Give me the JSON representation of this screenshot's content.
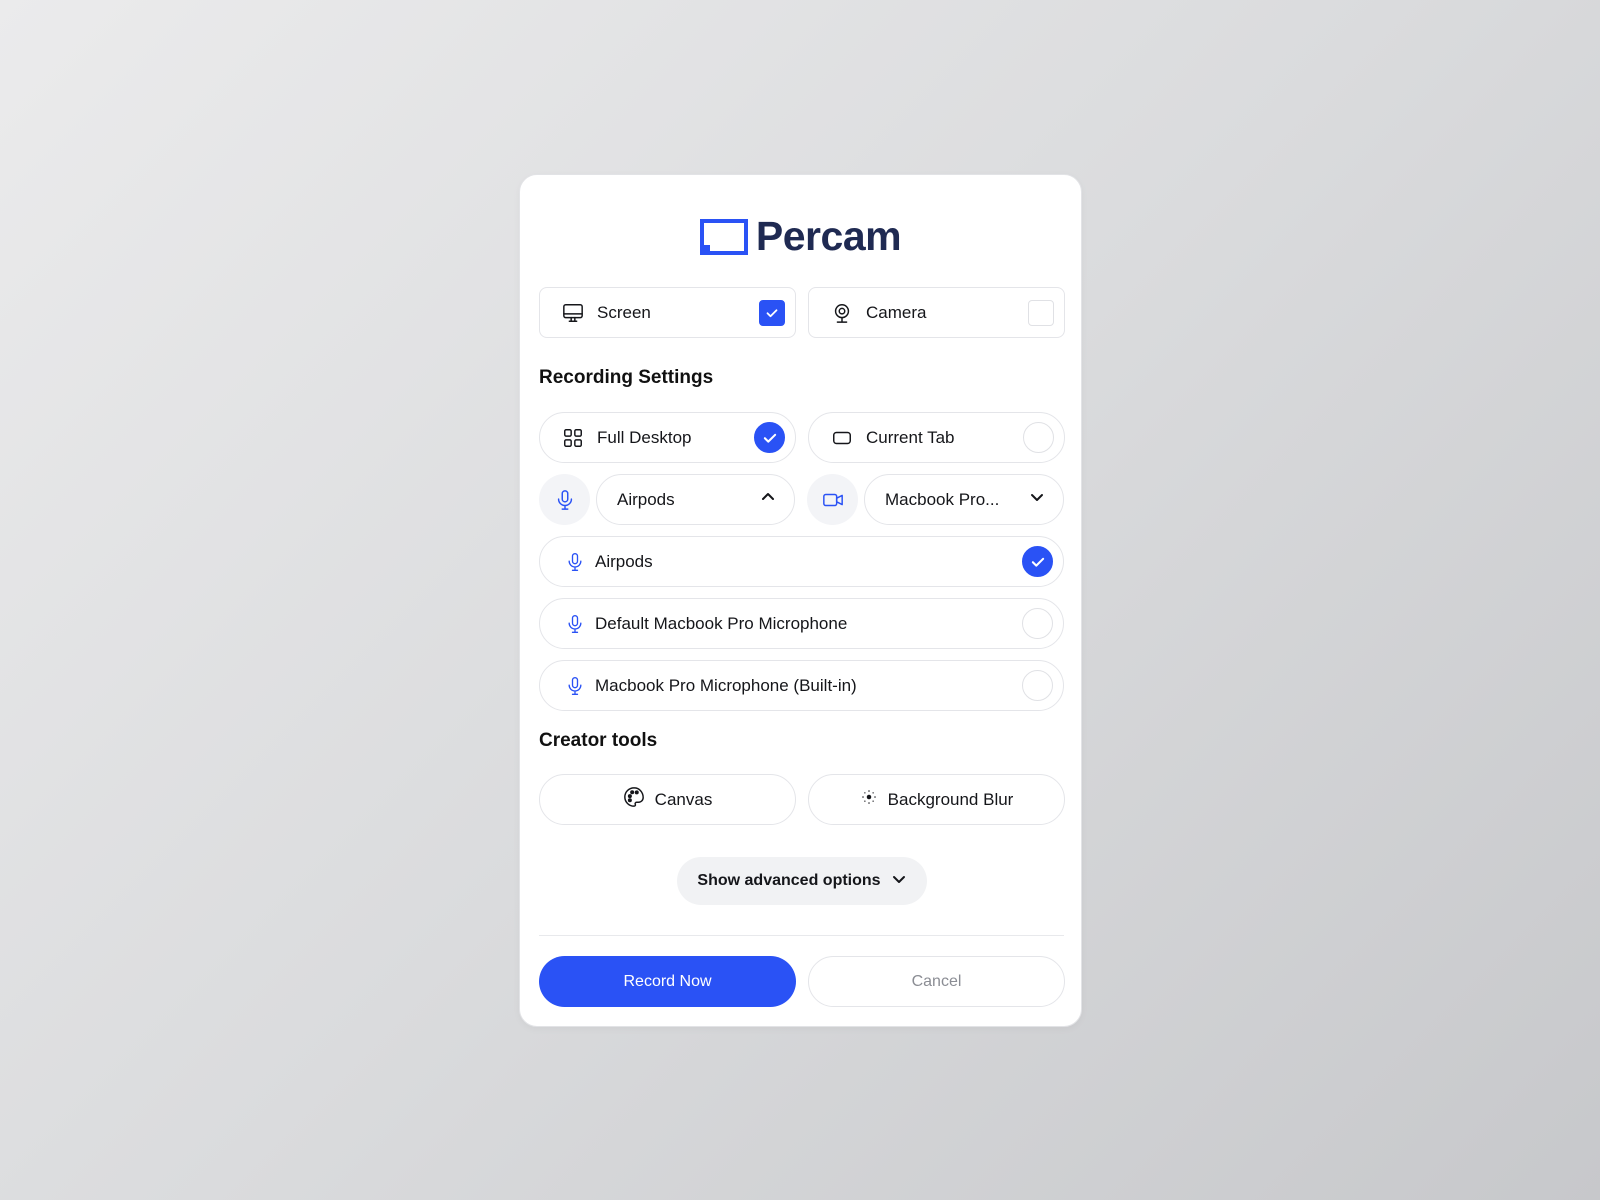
{
  "brand": {
    "name": "Percam",
    "accent": "#2a52f5",
    "text_color": "#1f2a52"
  },
  "sources": [
    {
      "label": "Screen",
      "icon": "monitor-icon",
      "checked": true
    },
    {
      "label": "Camera",
      "icon": "webcam-icon",
      "checked": false
    }
  ],
  "recording_settings": {
    "title": "Recording Settings",
    "modes": [
      {
        "label": "Full Desktop",
        "icon": "grid-icon",
        "selected": true
      },
      {
        "label": "Current Tab",
        "icon": "tab-icon",
        "selected": false
      }
    ],
    "microphone_select": {
      "value": "Airpods",
      "icon": "microphone-icon",
      "expanded": true
    },
    "camera_select": {
      "value": "Macbook Pro...",
      "icon": "video-camera-icon",
      "expanded": false
    },
    "microphone_options": [
      {
        "label": "Airpods",
        "selected": true
      },
      {
        "label": "Default Macbook Pro Microphone",
        "selected": false
      },
      {
        "label": "Macbook Pro Microphone (Built-in)",
        "selected": false
      }
    ]
  },
  "creator_tools": {
    "title": "Creator tools",
    "items": [
      {
        "label": "Canvas",
        "icon": "palette-icon"
      },
      {
        "label": "Background Blur",
        "icon": "blur-icon"
      }
    ]
  },
  "advanced": {
    "label": "Show advanced options"
  },
  "actions": {
    "record_label": "Record Now",
    "cancel_label": "Cancel"
  }
}
